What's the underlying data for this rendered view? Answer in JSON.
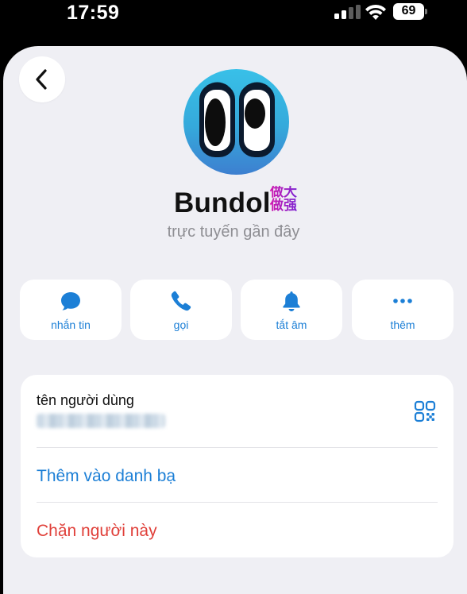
{
  "status_bar": {
    "time": "17:59",
    "battery": "69"
  },
  "profile": {
    "name": "Bundol",
    "badge": "做大\n做强",
    "status": "trực tuyến gần đây"
  },
  "actions": [
    {
      "label": "nhắn tin",
      "icon": "message-bubble-icon"
    },
    {
      "label": "gọi",
      "icon": "phone-icon"
    },
    {
      "label": "tắt âm",
      "icon": "bell-icon"
    },
    {
      "label": "thêm",
      "icon": "more-dots-icon"
    }
  ],
  "info": {
    "username_label": "tên người dùng",
    "username_value": "",
    "add_contact": "Thêm vào danh bạ",
    "block": "Chặn người này"
  },
  "colors": {
    "accent": "#1c7fd6",
    "danger": "#e0403a",
    "background": "#efeff4"
  }
}
